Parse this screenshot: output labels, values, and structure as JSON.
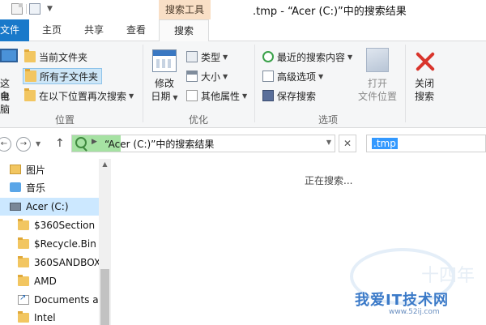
{
  "title_bar": {
    "context_tab_header": "搜索工具",
    "window_title": ".tmp - “Acer (C:)”中的搜索结果"
  },
  "tabs": {
    "file": "文件",
    "home": "主页",
    "share": "共享",
    "view": "查看",
    "search": "搜索"
  },
  "ribbon": {
    "location": {
      "computer_label_1": "这台",
      "computer_label_2": "电脑",
      "current_folder": "当前文件夹",
      "all_subfolders": "所有子文件夹",
      "search_again_in": "在以下位置再次搜索"
    },
    "refine": {
      "date_modified_1": "修改",
      "date_modified_2": "日期",
      "type": "类型",
      "size": "大小",
      "other_properties": "其他属性"
    },
    "options": {
      "recent_searches": "最近的搜索内容",
      "advanced_options": "高级选项",
      "save_search": "保存搜索",
      "open_location_1": "打开",
      "open_location_2": "文件位置"
    },
    "close": {
      "close_1": "关闭",
      "close_2": "搜索"
    },
    "group_labels": {
      "location": "位置",
      "refine": "优化",
      "options": "选项"
    }
  },
  "address_bar": {
    "path": "“Acer (C:)”中的搜索结果",
    "search_value": ".tmp"
  },
  "nav_pane": {
    "items": [
      {
        "label": "图片"
      },
      {
        "label": "音乐"
      },
      {
        "label": "Acer (C:)"
      },
      {
        "label": "$360Section"
      },
      {
        "label": "$Recycle.Bin"
      },
      {
        "label": "360SANDBOX"
      },
      {
        "label": "AMD"
      },
      {
        "label": "Documents and Settings"
      },
      {
        "label": "Intel"
      }
    ]
  },
  "content": {
    "status": "正在搜索..."
  },
  "watermark": {
    "text": "我爱IT技术网",
    "url": "www.52ij.com",
    "dim": "十四年"
  },
  "colors": {
    "file_tab": "#1979ca",
    "context_header": "#f9dfc6",
    "selected": "#cde6f7",
    "address_progress": "#a6e2a3",
    "search_highlight": "#3399ff"
  }
}
